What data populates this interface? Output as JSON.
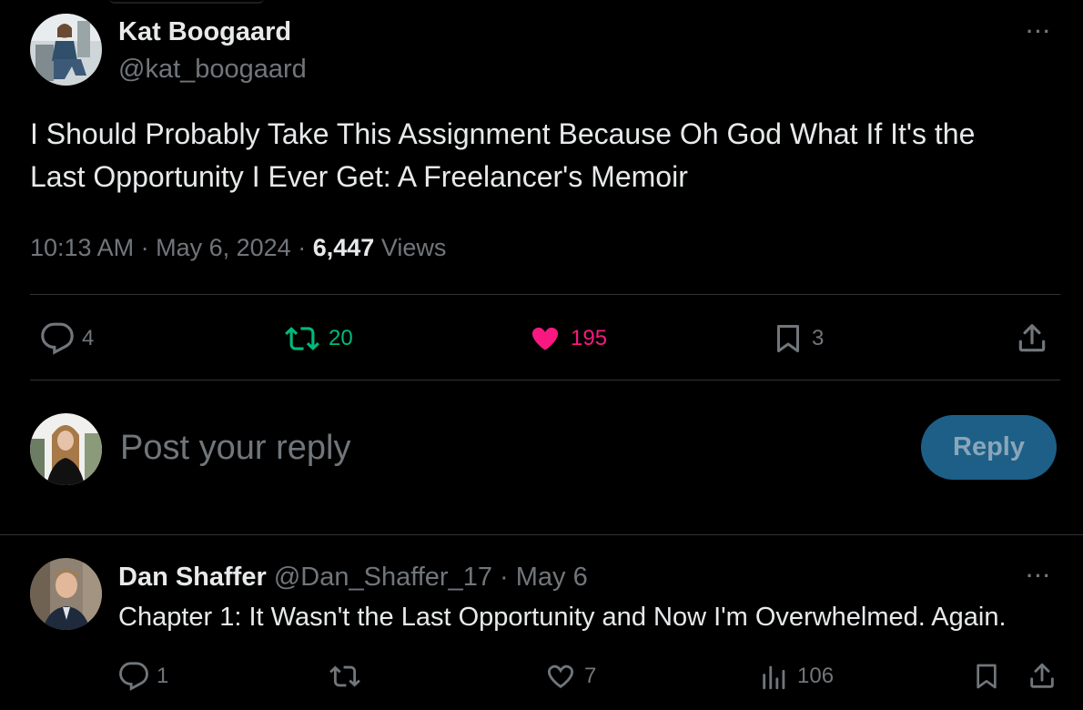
{
  "colors": {
    "background": "#000000",
    "text": "#e7e9ea",
    "muted": "#71767b",
    "divider": "#2f3336",
    "repost_green": "#00ba7c",
    "like_pink": "#f91880",
    "reply_button_bg": "#1d5f87"
  },
  "post": {
    "author_name": "Kat Boogaard",
    "author_handle": "@kat_boogaard",
    "text_line1": "I Should Probably Take This Assignment Because Oh God What If It's the",
    "text_line2": "Last Opportunity I Ever Get: A Freelancer's Memoir",
    "time": "10:13 AM",
    "separator": "·",
    "date": "May 6, 2024",
    "views_count": "6,447",
    "views_label": "Views",
    "more_label": "···",
    "actions": {
      "replies": "4",
      "reposts": "20",
      "likes": "195",
      "bookmarks": "3"
    },
    "reposted": true,
    "liked": true
  },
  "composer": {
    "placeholder": "Post your reply",
    "reply_button": "Reply"
  },
  "reply": {
    "author_name": "Dan Shaffer",
    "author_handle": "@Dan_Shaffer_17",
    "separator": "·",
    "date": "May 6",
    "text": "Chapter 1: It Wasn't the Last Opportunity and Now I'm Overwhelmed. Again.",
    "more_label": "···",
    "actions": {
      "replies": "1",
      "likes": "7",
      "views": "106"
    }
  },
  "icons": [
    "reply-icon",
    "repost-icon",
    "heart-icon",
    "bookmark-icon",
    "share-icon",
    "views-icon",
    "more-icon"
  ]
}
